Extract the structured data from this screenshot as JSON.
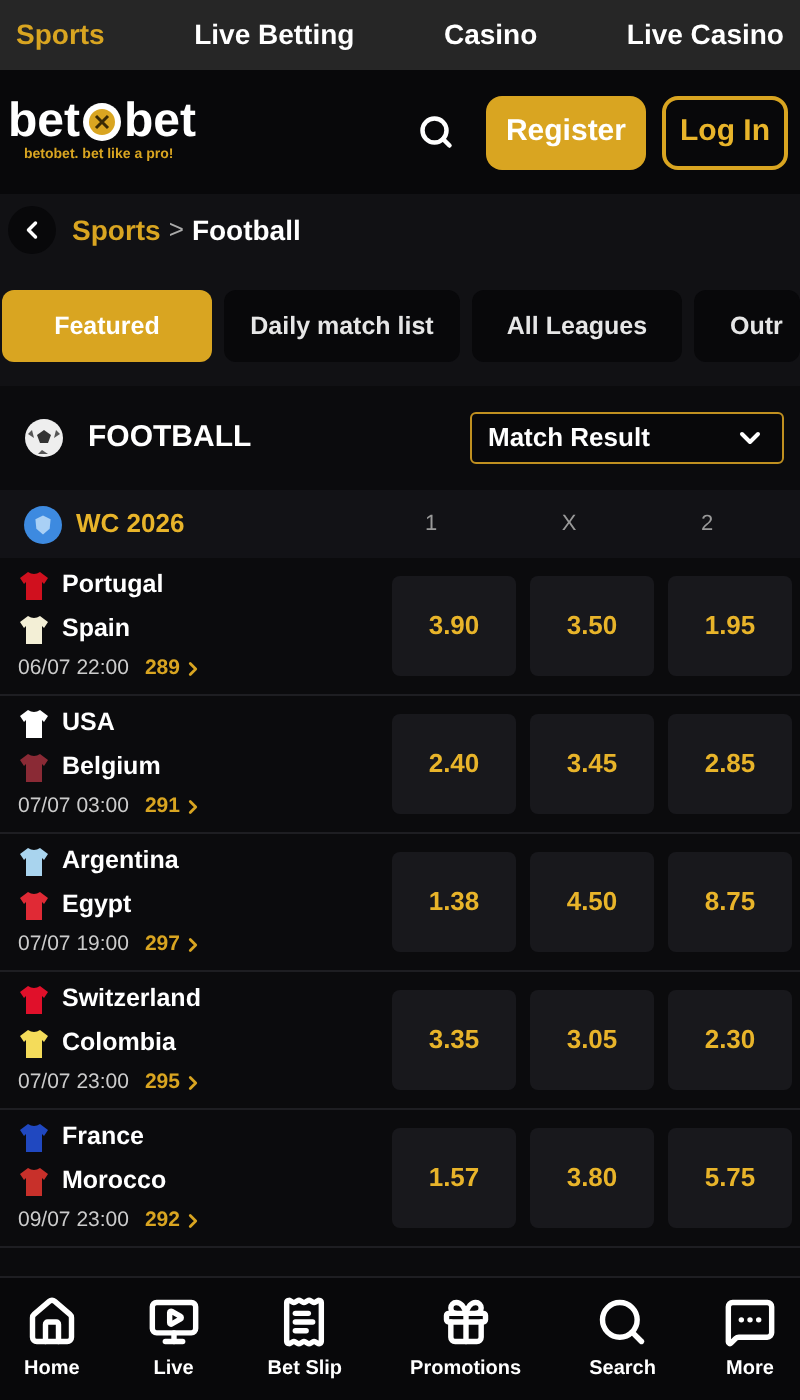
{
  "top_nav": [
    {
      "label": "Sports",
      "selected": true
    },
    {
      "label": "Live Betting",
      "selected": false
    },
    {
      "label": "Casino",
      "selected": false
    },
    {
      "label": "Live Casino",
      "selected": false
    }
  ],
  "header": {
    "logo_left": "bet",
    "logo_right": "bet",
    "tagline": "betobet. bet like a pro!",
    "register": "Register",
    "login": "Log In"
  },
  "breadcrumb": {
    "parent": "Sports",
    "separator": ">",
    "current": "Football"
  },
  "tabs": [
    {
      "label": "Featured",
      "selected": true
    },
    {
      "label": "Daily match list",
      "selected": false
    },
    {
      "label": "All Leagues",
      "selected": false
    },
    {
      "label": "Outr",
      "selected": false
    }
  ],
  "section": {
    "title": "FOOTBALL",
    "market": "Match Result"
  },
  "league": {
    "name": "WC 2026",
    "columns": [
      "1",
      "X",
      "2"
    ]
  },
  "matches": [
    {
      "home": {
        "name": "Portugal",
        "color": "#d0101e"
      },
      "away": {
        "name": "Spain",
        "color": "#f3efd6"
      },
      "time": "06/07 22:00",
      "markets": "289",
      "odds": [
        "3.90",
        "3.50",
        "1.95"
      ]
    },
    {
      "home": {
        "name": "USA",
        "color": "#ffffff"
      },
      "away": {
        "name": "Belgium",
        "color": "#8a2a35"
      },
      "time": "07/07 03:00",
      "markets": "291",
      "odds": [
        "2.40",
        "3.45",
        "2.85"
      ]
    },
    {
      "home": {
        "name": "Argentina",
        "color": "#a9d4ee"
      },
      "away": {
        "name": "Egypt",
        "color": "#e02a35"
      },
      "time": "07/07 19:00",
      "markets": "297",
      "odds": [
        "1.38",
        "4.50",
        "8.75"
      ]
    },
    {
      "home": {
        "name": "Switzerland",
        "color": "#e0102a"
      },
      "away": {
        "name": "Colombia",
        "color": "#f4dc5a"
      },
      "time": "07/07 23:00",
      "markets": "295",
      "odds": [
        "3.35",
        "3.05",
        "2.30"
      ]
    },
    {
      "home": {
        "name": "France",
        "color": "#2048c0"
      },
      "away": {
        "name": "Morocco",
        "color": "#c8302a"
      },
      "time": "09/07 23:00",
      "markets": "292",
      "odds": [
        "1.57",
        "3.80",
        "5.75"
      ]
    }
  ],
  "bottom_nav": [
    {
      "kind": "home",
      "label": "Home"
    },
    {
      "kind": "live",
      "label": "Live"
    },
    {
      "kind": "betslip",
      "label": "Bet Slip"
    },
    {
      "kind": "promotions",
      "label": "Promotions"
    },
    {
      "kind": "search",
      "label": "Search"
    },
    {
      "kind": "more",
      "label": "More"
    }
  ]
}
